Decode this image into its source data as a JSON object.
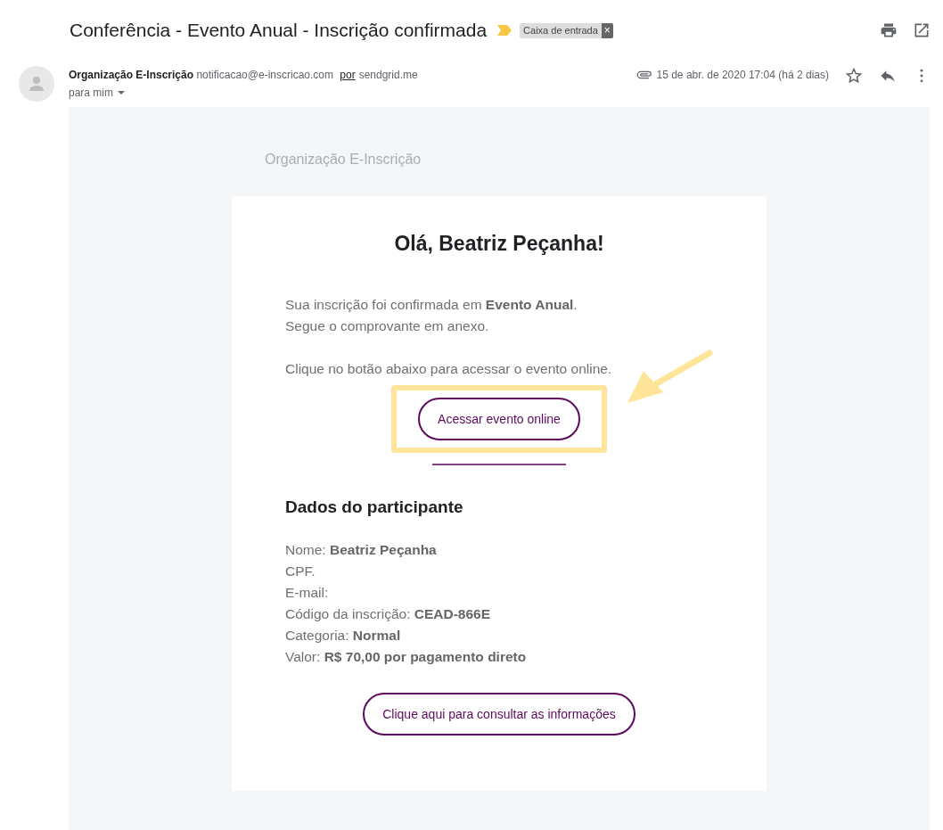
{
  "subject": "Conferência - Evento Anual - Inscrição confirmada",
  "label": {
    "text": "Caixa de entrada",
    "remove": "×"
  },
  "sender": {
    "name": "Organização E-Inscrição",
    "email": "notificacao@e-inscricao.com",
    "via": "por",
    "via_domain": "sendgrid.me",
    "to": "para mim",
    "date": "15 de abr. de 2020 17:04 (há 2 dias)"
  },
  "email": {
    "brand": "Organização E-Inscrição",
    "greeting": "Olá, Beatriz Peçanha!",
    "intro": [
      "Sua inscrição foi confirmada em **Evento Anual**.",
      "Segue o comprovante em anexo."
    ],
    "instruction": "Clique no botão abaixo para acessar o evento online.",
    "primary_button": "Acessar evento online",
    "section_title": "Dados do participante",
    "details": [
      "Nome: **Beatriz Peçanha**",
      "CPF.",
      "E-mail:",
      "Código da inscrição: **CEAD-866E**",
      "Categoria: **Normal**",
      "Valor: **R$ 70,00 por pagamento direto**"
    ],
    "secondary_button": "Clique aqui para consultar as informações"
  }
}
